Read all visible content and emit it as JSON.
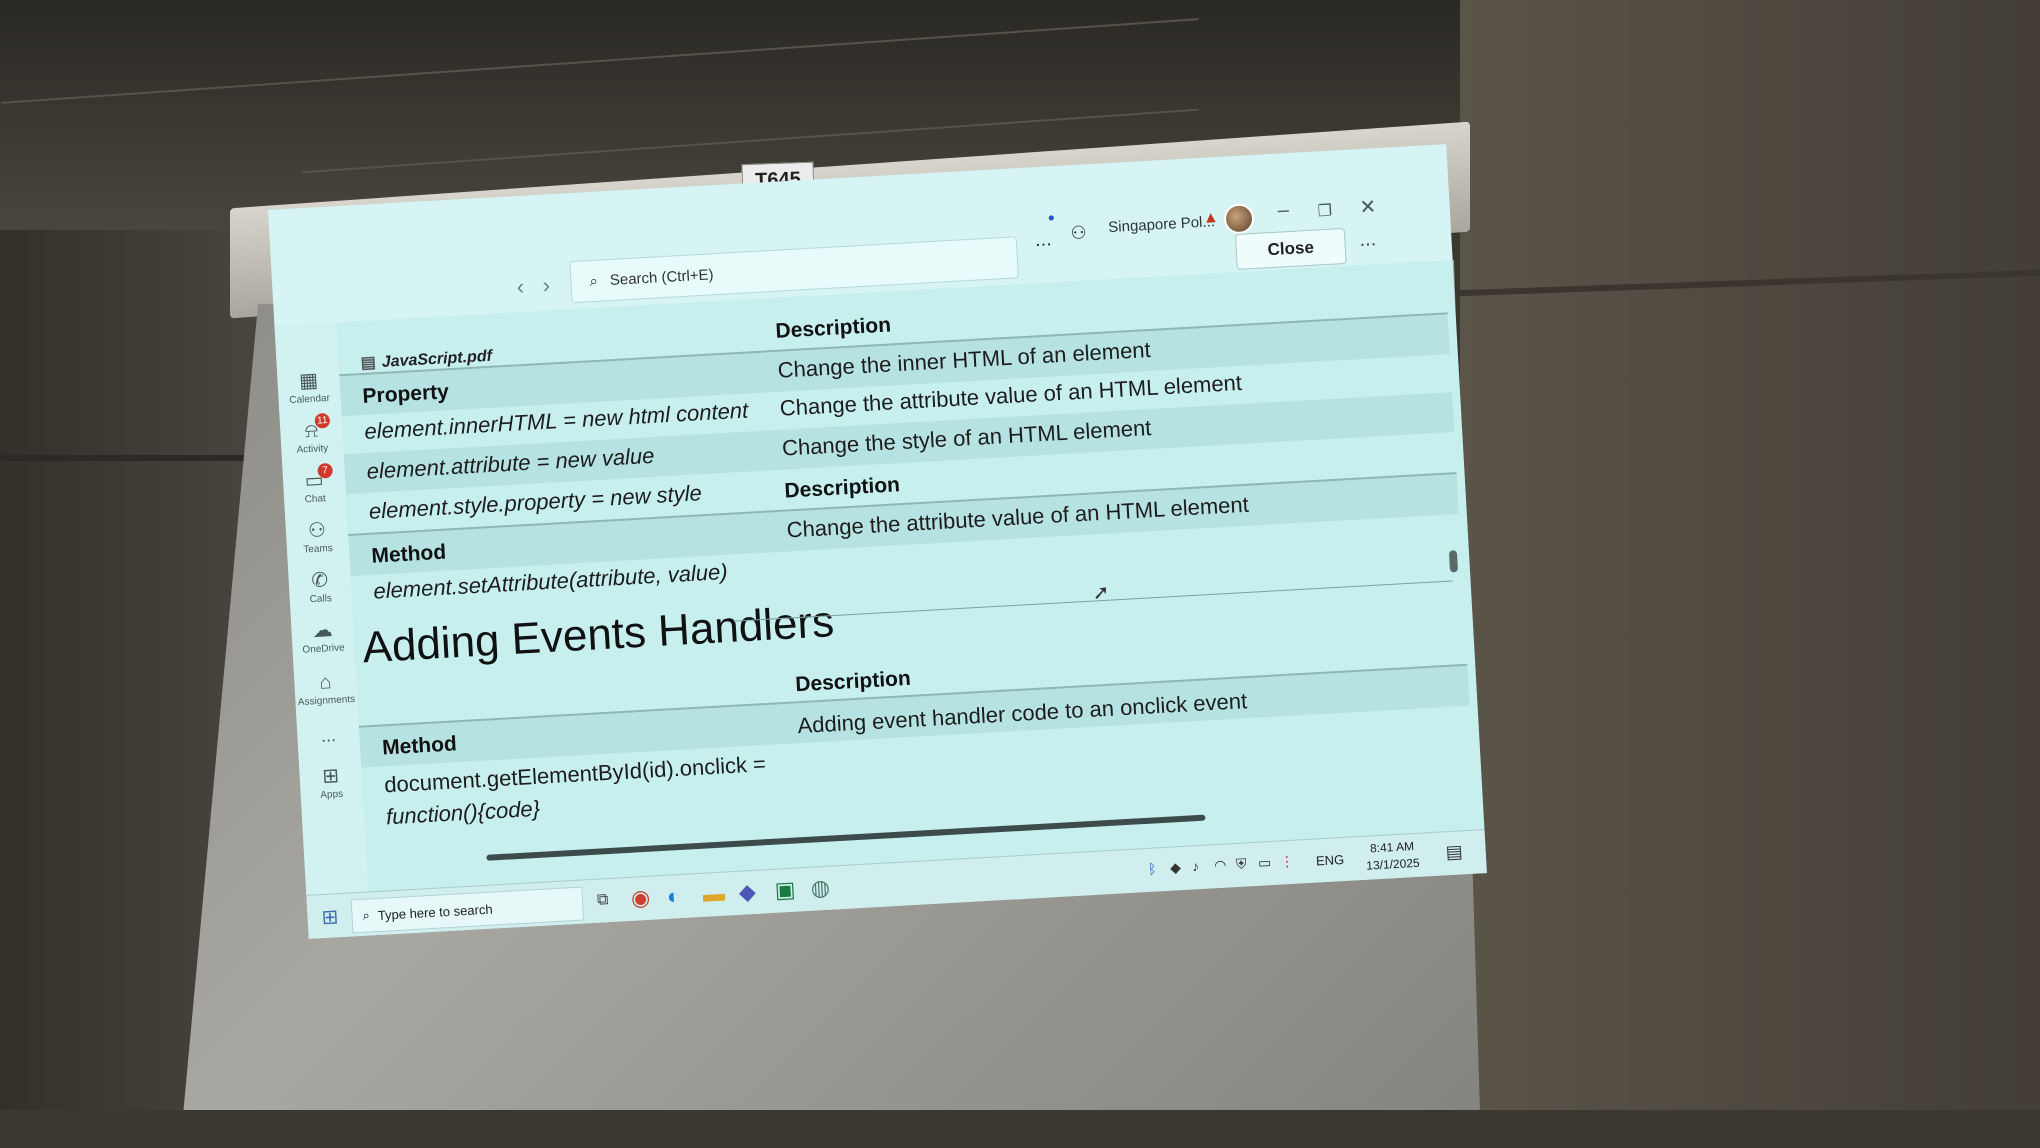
{
  "room": {
    "label": "T645"
  },
  "window": {
    "search_placeholder": "Search (Ctrl+E)",
    "org_name": "Singapore Pol...",
    "close_label": "Close",
    "more_label": "...",
    "titlebar_more": "...",
    "minimize": "–",
    "restore": "❐",
    "close_x": "✕",
    "back": "‹",
    "forward": "›"
  },
  "rail": {
    "items": [
      {
        "label": "Calendar",
        "icon": "calendar-icon",
        "glyph": "▦"
      },
      {
        "label": "Activity",
        "icon": "bell-icon",
        "glyph": "🔔",
        "badge": "11"
      },
      {
        "label": "Chat",
        "icon": "chat-icon",
        "glyph": "💬",
        "badge": "7"
      },
      {
        "label": "Teams",
        "icon": "teams-icon",
        "glyph": "👥"
      },
      {
        "label": "Calls",
        "icon": "phone-icon",
        "glyph": "✆"
      },
      {
        "label": "OneDrive",
        "icon": "cloud-icon",
        "glyph": "☁"
      },
      {
        "label": "Assignments",
        "icon": "backpack-icon",
        "glyph": "🎒"
      },
      {
        "label": "...",
        "icon": "more-icon",
        "glyph": ""
      },
      {
        "label": "Apps",
        "icon": "add-app-icon",
        "glyph": "⊞"
      }
    ]
  },
  "document": {
    "file_name": "JavaScript.pdf",
    "table1": {
      "header_property": "Property",
      "header_description": "Description",
      "rows": [
        {
          "code": "element.innerHTML =  new html content",
          "desc": "Change the inner HTML of an element"
        },
        {
          "code": "element.attribute = new value",
          "desc": "Change the attribute value of an HTML element"
        },
        {
          "code": "element.style.property = new style",
          "desc": "Change the style of an HTML element"
        }
      ]
    },
    "table2": {
      "header_method": "Method",
      "header_description": "Description",
      "rows": [
        {
          "code": "element.setAttribute(attribute, value)",
          "desc": "Change the attribute value of an HTML element"
        }
      ]
    },
    "section_heading": "Adding Events Handlers",
    "table3": {
      "header_method": "Method",
      "header_description": "Description",
      "rows": [
        {
          "code_line1": "document.getElementById(id).onclick =",
          "code_line2": "function(){code}",
          "desc": "Adding event handler code to an onclick event"
        }
      ]
    }
  },
  "taskbar": {
    "search_placeholder": "Type here to search",
    "language": "ENG",
    "time": "8:41 AM",
    "date": "13/1/2025"
  }
}
